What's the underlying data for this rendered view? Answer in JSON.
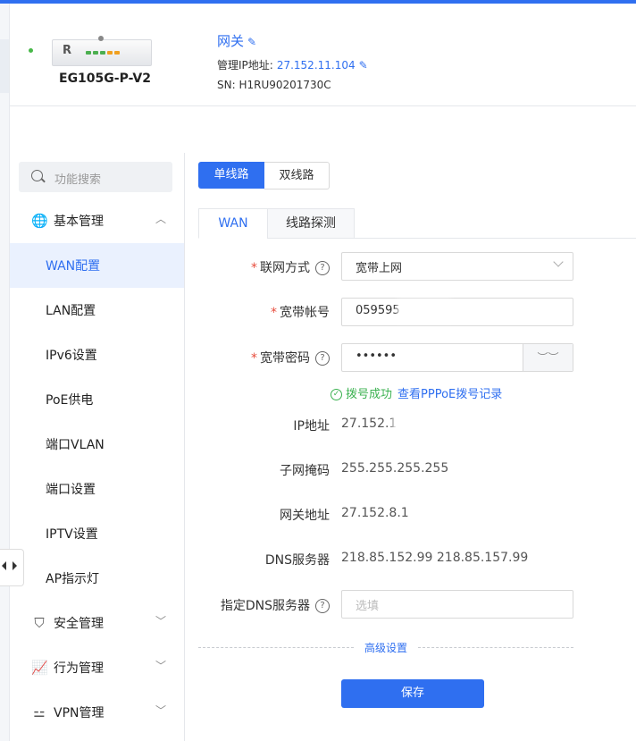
{
  "header": {
    "device_model": "EG105G-P-V2",
    "device_logo": "R",
    "gateway_name": "网关",
    "mgmt_ip_label": "管理IP地址:",
    "mgmt_ip": "27.152.11.104",
    "sn": "SN: H1RU90201730C"
  },
  "sidebar": {
    "search_placeholder": "功能搜索",
    "groups": [
      {
        "label": "基本管理",
        "icon": "globe-icon"
      },
      {
        "label": "安全管理",
        "icon": "shield-icon"
      },
      {
        "label": "行为管理",
        "icon": "chart-icon"
      },
      {
        "label": "VPN管理",
        "icon": "network-icon"
      }
    ],
    "items": [
      "WAN配置",
      "LAN配置",
      "IPv6设置",
      "PoE供电",
      "端口VLAN",
      "端口设置",
      "IPTV设置",
      "AP指示灯"
    ],
    "active_item": "WAN配置"
  },
  "segments": {
    "single": "单线路",
    "dual": "双线路"
  },
  "tabs": {
    "wan": "WAN",
    "probe": "线路探测"
  },
  "form": {
    "mode_label": "联网方式",
    "mode_value": "宽带上网",
    "account_label": "宽带帐号",
    "account_value": "059595",
    "password_label": "宽带密码",
    "password_value": "••••••",
    "status_text": "拨号成功",
    "status_link": "查看PPPoE拨号记录",
    "ip_label": "IP地址",
    "ip_value": "27.152.1",
    "mask_label": "子网掩码",
    "mask_value": "255.255.255.255",
    "gateway_label": "网关地址",
    "gateway_value": "27.152.8.1",
    "dns_label": "DNS服务器",
    "dns_value": "218.85.152.99 218.85.157.99",
    "custom_dns_label": "指定DNS服务器",
    "custom_dns_placeholder": "选填",
    "advanced": "高级设置",
    "save": "保存"
  },
  "colors": {
    "accent": "#2f6ff0",
    "success": "#3cb251",
    "required": "#e74c3c"
  }
}
